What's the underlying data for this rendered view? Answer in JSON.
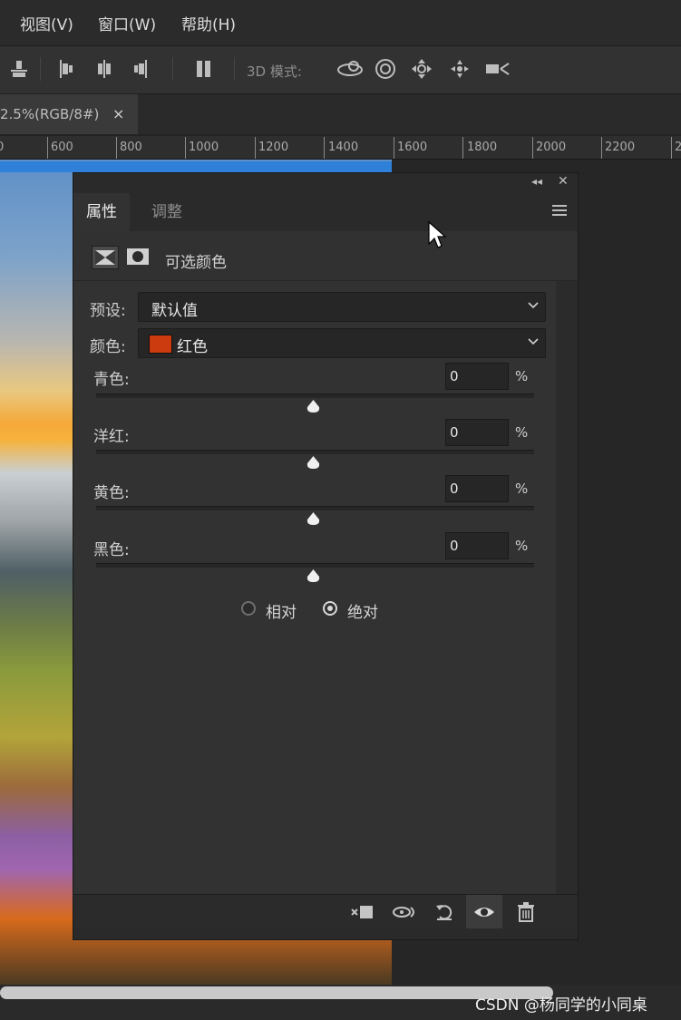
{
  "menu": {
    "view": "视图(V)",
    "window": "窗口(W)",
    "help": "帮助(H)"
  },
  "options_bar": {
    "mode_label": "3D 模式:"
  },
  "document_tab": {
    "label": "2.5%(RGB/8#)",
    "close": "×"
  },
  "ruler": {
    "labels": [
      "0",
      "600",
      "800",
      "1000",
      "1200",
      "1400",
      "1600",
      "1800",
      "2000",
      "2200",
      "2"
    ]
  },
  "panel": {
    "tabs": [
      "属性",
      "调整"
    ],
    "adjustment_title": "可选颜色",
    "preset_label": "预设:",
    "preset_value": "默认值",
    "color_label": "颜色:",
    "color_value": "红色",
    "color_swatch": "#cc3a10",
    "sliders": [
      {
        "label": "青色:",
        "value": "0",
        "unit": "%"
      },
      {
        "label": "洋红:",
        "value": "0",
        "unit": "%"
      },
      {
        "label": "黄色:",
        "value": "0",
        "unit": "%"
      },
      {
        "label": "黑色:",
        "value": "0",
        "unit": "%"
      }
    ],
    "method": {
      "relative": "相对",
      "absolute": "绝对",
      "selected": "absolute"
    }
  },
  "watermark": "CSDN @杨同学的小同桌",
  "colors": {
    "selection_accent": "#2f80d8",
    "panel_bg": "#323232"
  }
}
